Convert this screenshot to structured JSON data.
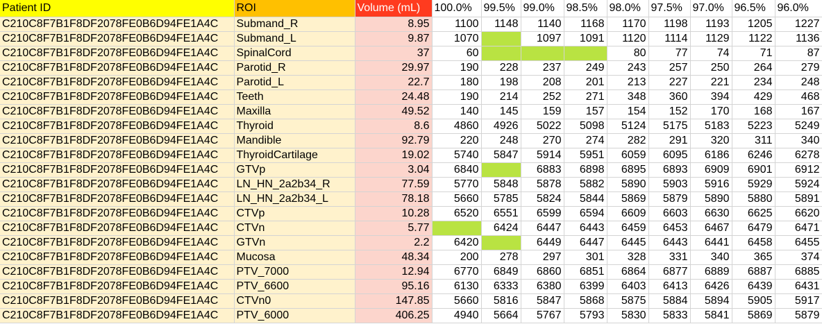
{
  "headers": [
    "Patient ID",
    "ROI",
    "Volume (mL)",
    "100.0%",
    "99.5%",
    "99.0%",
    "98.5%",
    "98.0%",
    "97.5%",
    "97.0%",
    "96.5%",
    "96.0%"
  ],
  "highlight_color": "#b9e342",
  "rows": [
    [
      "C210C8F7B1F8DF2078FE0B6D94FE1A4C",
      "Submand_R",
      "8.95",
      "1100",
      "1148",
      "1140",
      "1168",
      "1170",
      "1198",
      "1193",
      "1205",
      "1227"
    ],
    [
      "C210C8F7B1F8DF2078FE0B6D94FE1A4C",
      "Submand_L",
      "9.87",
      "1070",
      "",
      "1097",
      "1091",
      "1120",
      "1114",
      "1129",
      "1122",
      "1136"
    ],
    [
      "C210C8F7B1F8DF2078FE0B6D94FE1A4C",
      "SpinalCord",
      "37",
      "60",
      "",
      "",
      "",
      "80",
      "77",
      "74",
      "71",
      "87"
    ],
    [
      "C210C8F7B1F8DF2078FE0B6D94FE1A4C",
      "Parotid_R",
      "29.97",
      "190",
      "228",
      "237",
      "249",
      "243",
      "257",
      "250",
      "264",
      "279"
    ],
    [
      "C210C8F7B1F8DF2078FE0B6D94FE1A4C",
      "Parotid_L",
      "22.7",
      "180",
      "198",
      "208",
      "201",
      "213",
      "227",
      "221",
      "234",
      "248"
    ],
    [
      "C210C8F7B1F8DF2078FE0B6D94FE1A4C",
      "Teeth",
      "24.48",
      "190",
      "214",
      "252",
      "271",
      "348",
      "360",
      "394",
      "429",
      "468"
    ],
    [
      "C210C8F7B1F8DF2078FE0B6D94FE1A4C",
      "Maxilla",
      "49.52",
      "140",
      "145",
      "159",
      "157",
      "154",
      "152",
      "170",
      "168",
      "167"
    ],
    [
      "C210C8F7B1F8DF2078FE0B6D94FE1A4C",
      "Thyroid",
      "8.6",
      "4860",
      "4926",
      "5022",
      "5098",
      "5124",
      "5175",
      "5183",
      "5223",
      "5249"
    ],
    [
      "C210C8F7B1F8DF2078FE0B6D94FE1A4C",
      "Mandible",
      "92.79",
      "220",
      "248",
      "270",
      "274",
      "282",
      "291",
      "320",
      "311",
      "340"
    ],
    [
      "C210C8F7B1F8DF2078FE0B6D94FE1A4C",
      "ThyroidCartilage",
      "19.02",
      "5740",
      "5847",
      "5914",
      "5951",
      "6059",
      "6095",
      "6186",
      "6246",
      "6278"
    ],
    [
      "C210C8F7B1F8DF2078FE0B6D94FE1A4C",
      "GTVp",
      "3.04",
      "6840",
      "",
      "6883",
      "6898",
      "6895",
      "6893",
      "6909",
      "6901",
      "6912"
    ],
    [
      "C210C8F7B1F8DF2078FE0B6D94FE1A4C",
      "LN_HN_2a2b34_R",
      "77.59",
      "5770",
      "5848",
      "5878",
      "5882",
      "5890",
      "5903",
      "5916",
      "5929",
      "5924"
    ],
    [
      "C210C8F7B1F8DF2078FE0B6D94FE1A4C",
      "LN_HN_2a2b34_L",
      "78.18",
      "5660",
      "5785",
      "5824",
      "5844",
      "5869",
      "5879",
      "5890",
      "5880",
      "5891"
    ],
    [
      "C210C8F7B1F8DF2078FE0B6D94FE1A4C",
      "CTVp",
      "10.28",
      "6520",
      "6551",
      "6599",
      "6594",
      "6609",
      "6603",
      "6630",
      "6625",
      "6620"
    ],
    [
      "C210C8F7B1F8DF2078FE0B6D94FE1A4C",
      "CTVn",
      "5.77",
      "",
      "6424",
      "6447",
      "6443",
      "6459",
      "6453",
      "6467",
      "6479",
      "6471"
    ],
    [
      "C210C8F7B1F8DF2078FE0B6D94FE1A4C",
      "GTVn",
      "2.2",
      "6420",
      "",
      "6449",
      "6447",
      "6445",
      "6443",
      "6441",
      "6458",
      "6455"
    ],
    [
      "C210C8F7B1F8DF2078FE0B6D94FE1A4C",
      "Mucosa",
      "48.34",
      "200",
      "278",
      "297",
      "301",
      "328",
      "331",
      "340",
      "365",
      "374"
    ],
    [
      "C210C8F7B1F8DF2078FE0B6D94FE1A4C",
      "PTV_7000",
      "12.94",
      "6770",
      "6849",
      "6860",
      "6851",
      "6864",
      "6877",
      "6889",
      "6887",
      "6885"
    ],
    [
      "C210C8F7B1F8DF2078FE0B6D94FE1A4C",
      "PTV_6600",
      "95.16",
      "6130",
      "6333",
      "6380",
      "6399",
      "6403",
      "6413",
      "6426",
      "6439",
      "6431"
    ],
    [
      "C210C8F7B1F8DF2078FE0B6D94FE1A4C",
      "CTVn0",
      "147.85",
      "5660",
      "5816",
      "5847",
      "5868",
      "5875",
      "5884",
      "5894",
      "5905",
      "5917"
    ],
    [
      "C210C8F7B1F8DF2078FE0B6D94FE1A4C",
      "PTV_6000",
      "406.25",
      "4940",
      "5664",
      "5767",
      "5793",
      "5830",
      "5833",
      "5841",
      "5869",
      "5879"
    ]
  ]
}
